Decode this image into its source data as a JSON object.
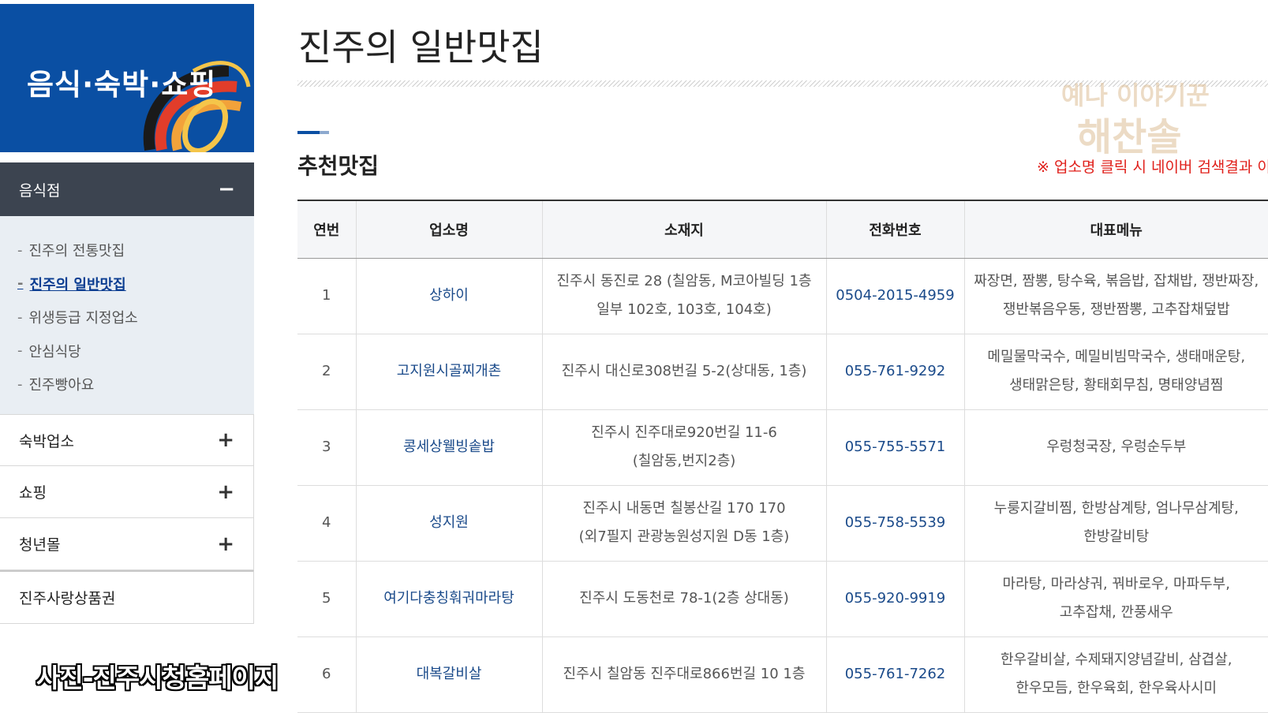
{
  "sidebar": {
    "banner_title": "음식·숙박·쇼핑",
    "active_section": {
      "label": "음식점",
      "toggle": "−"
    },
    "sub_items": [
      {
        "label": "진주의 전통맛집"
      },
      {
        "label": "진주의 일반맛집"
      },
      {
        "label": "위생등급 지정업소"
      },
      {
        "label": "안심식당"
      },
      {
        "label": "진주빵아요"
      }
    ],
    "sections": [
      {
        "label": "숙박업소",
        "toggle": "+"
      },
      {
        "label": "쇼핑",
        "toggle": "+"
      },
      {
        "label": "청년몰",
        "toggle": "+"
      },
      {
        "label": "진주사랑상품권"
      }
    ],
    "bullet": "-",
    "active_index": 1
  },
  "photo_credit": "사진-진주시청홈페이지",
  "main": {
    "page_title": "진주의 일반맛집",
    "watermark_top": "예나 이야기꾼",
    "watermark_bottom": "해찬솔",
    "section_title": "추천맛집",
    "notice": "※ 업소명 클릭 시 네이버 검색결과 이동"
  },
  "table": {
    "headers": [
      "연번",
      "업소명",
      "소재지",
      "전화번호",
      "대표메뉴"
    ],
    "rows": [
      {
        "no": "1",
        "name": "상하이",
        "address_1": "진주시 동진로 28 (칠암동, M코아빌딩 1층",
        "address_2": "일부 102호, 103호, 104호)",
        "phone": "0504-2015-4959",
        "menu_1": "짜장면, 짬뽕, 탕수육, 볶음밥, 잡채밥, 쟁반짜장,",
        "menu_2": "쟁반볶음우동, 쟁반짬뽕, 고추잡채덮밥"
      },
      {
        "no": "2",
        "name": "고지원시골찌개촌",
        "address_1": "진주시 대신로308번길 5-2(상대동, 1층)",
        "address_2": "",
        "phone": "055-761-9292",
        "menu_1": "메밀물막국수, 메밀비빔막국수, 생태매운탕,",
        "menu_2": "생태맑은탕, 황태회무침, 명태양념찜"
      },
      {
        "no": "3",
        "name": "콩세상웰빙솥밥",
        "address_1": "진주시 진주대로920번길 11-6",
        "address_2": "(칠암동,번지2층)",
        "phone": "055-755-5571",
        "menu_1": "우렁청국장, 우렁순두부",
        "menu_2": ""
      },
      {
        "no": "4",
        "name": "성지원",
        "address_1": "진주시 내동면 칠봉산길 170 170",
        "address_2": "(외7필지 관광농원성지원 D동 1층)",
        "phone": "055-758-5539",
        "menu_1": "누룽지갈비찜, 한방삼계탕, 엄나무삼계탕,",
        "menu_2": "한방갈비탕"
      },
      {
        "no": "5",
        "name": "여기다충칭훠궈마라탕",
        "address_1": "진주시 도동천로 78-1(2층 상대동)",
        "address_2": "",
        "phone": "055-920-9919",
        "menu_1": "마라탕, 마라샹궈, 꿔바로우, 마파두부,",
        "menu_2": "고추잡채, 깐풍새우"
      },
      {
        "no": "6",
        "name": "대복갈비살",
        "address_1": "진주시 칠암동 진주대로866번길 10 1층",
        "address_2": "",
        "phone": "055-761-7262",
        "menu_1": "한우갈비살, 수제돼지양념갈비, 삼겹살,",
        "menu_2": "한우모듬, 한우육회, 한우육사시미"
      }
    ]
  },
  "colors": {
    "banner_blue": "#0a4fa3",
    "menu_head_dark": "#3c4450",
    "submenu_bg": "#e9eef3",
    "link_blue": "#1a4a8a",
    "notice_red": "#e0201b"
  }
}
